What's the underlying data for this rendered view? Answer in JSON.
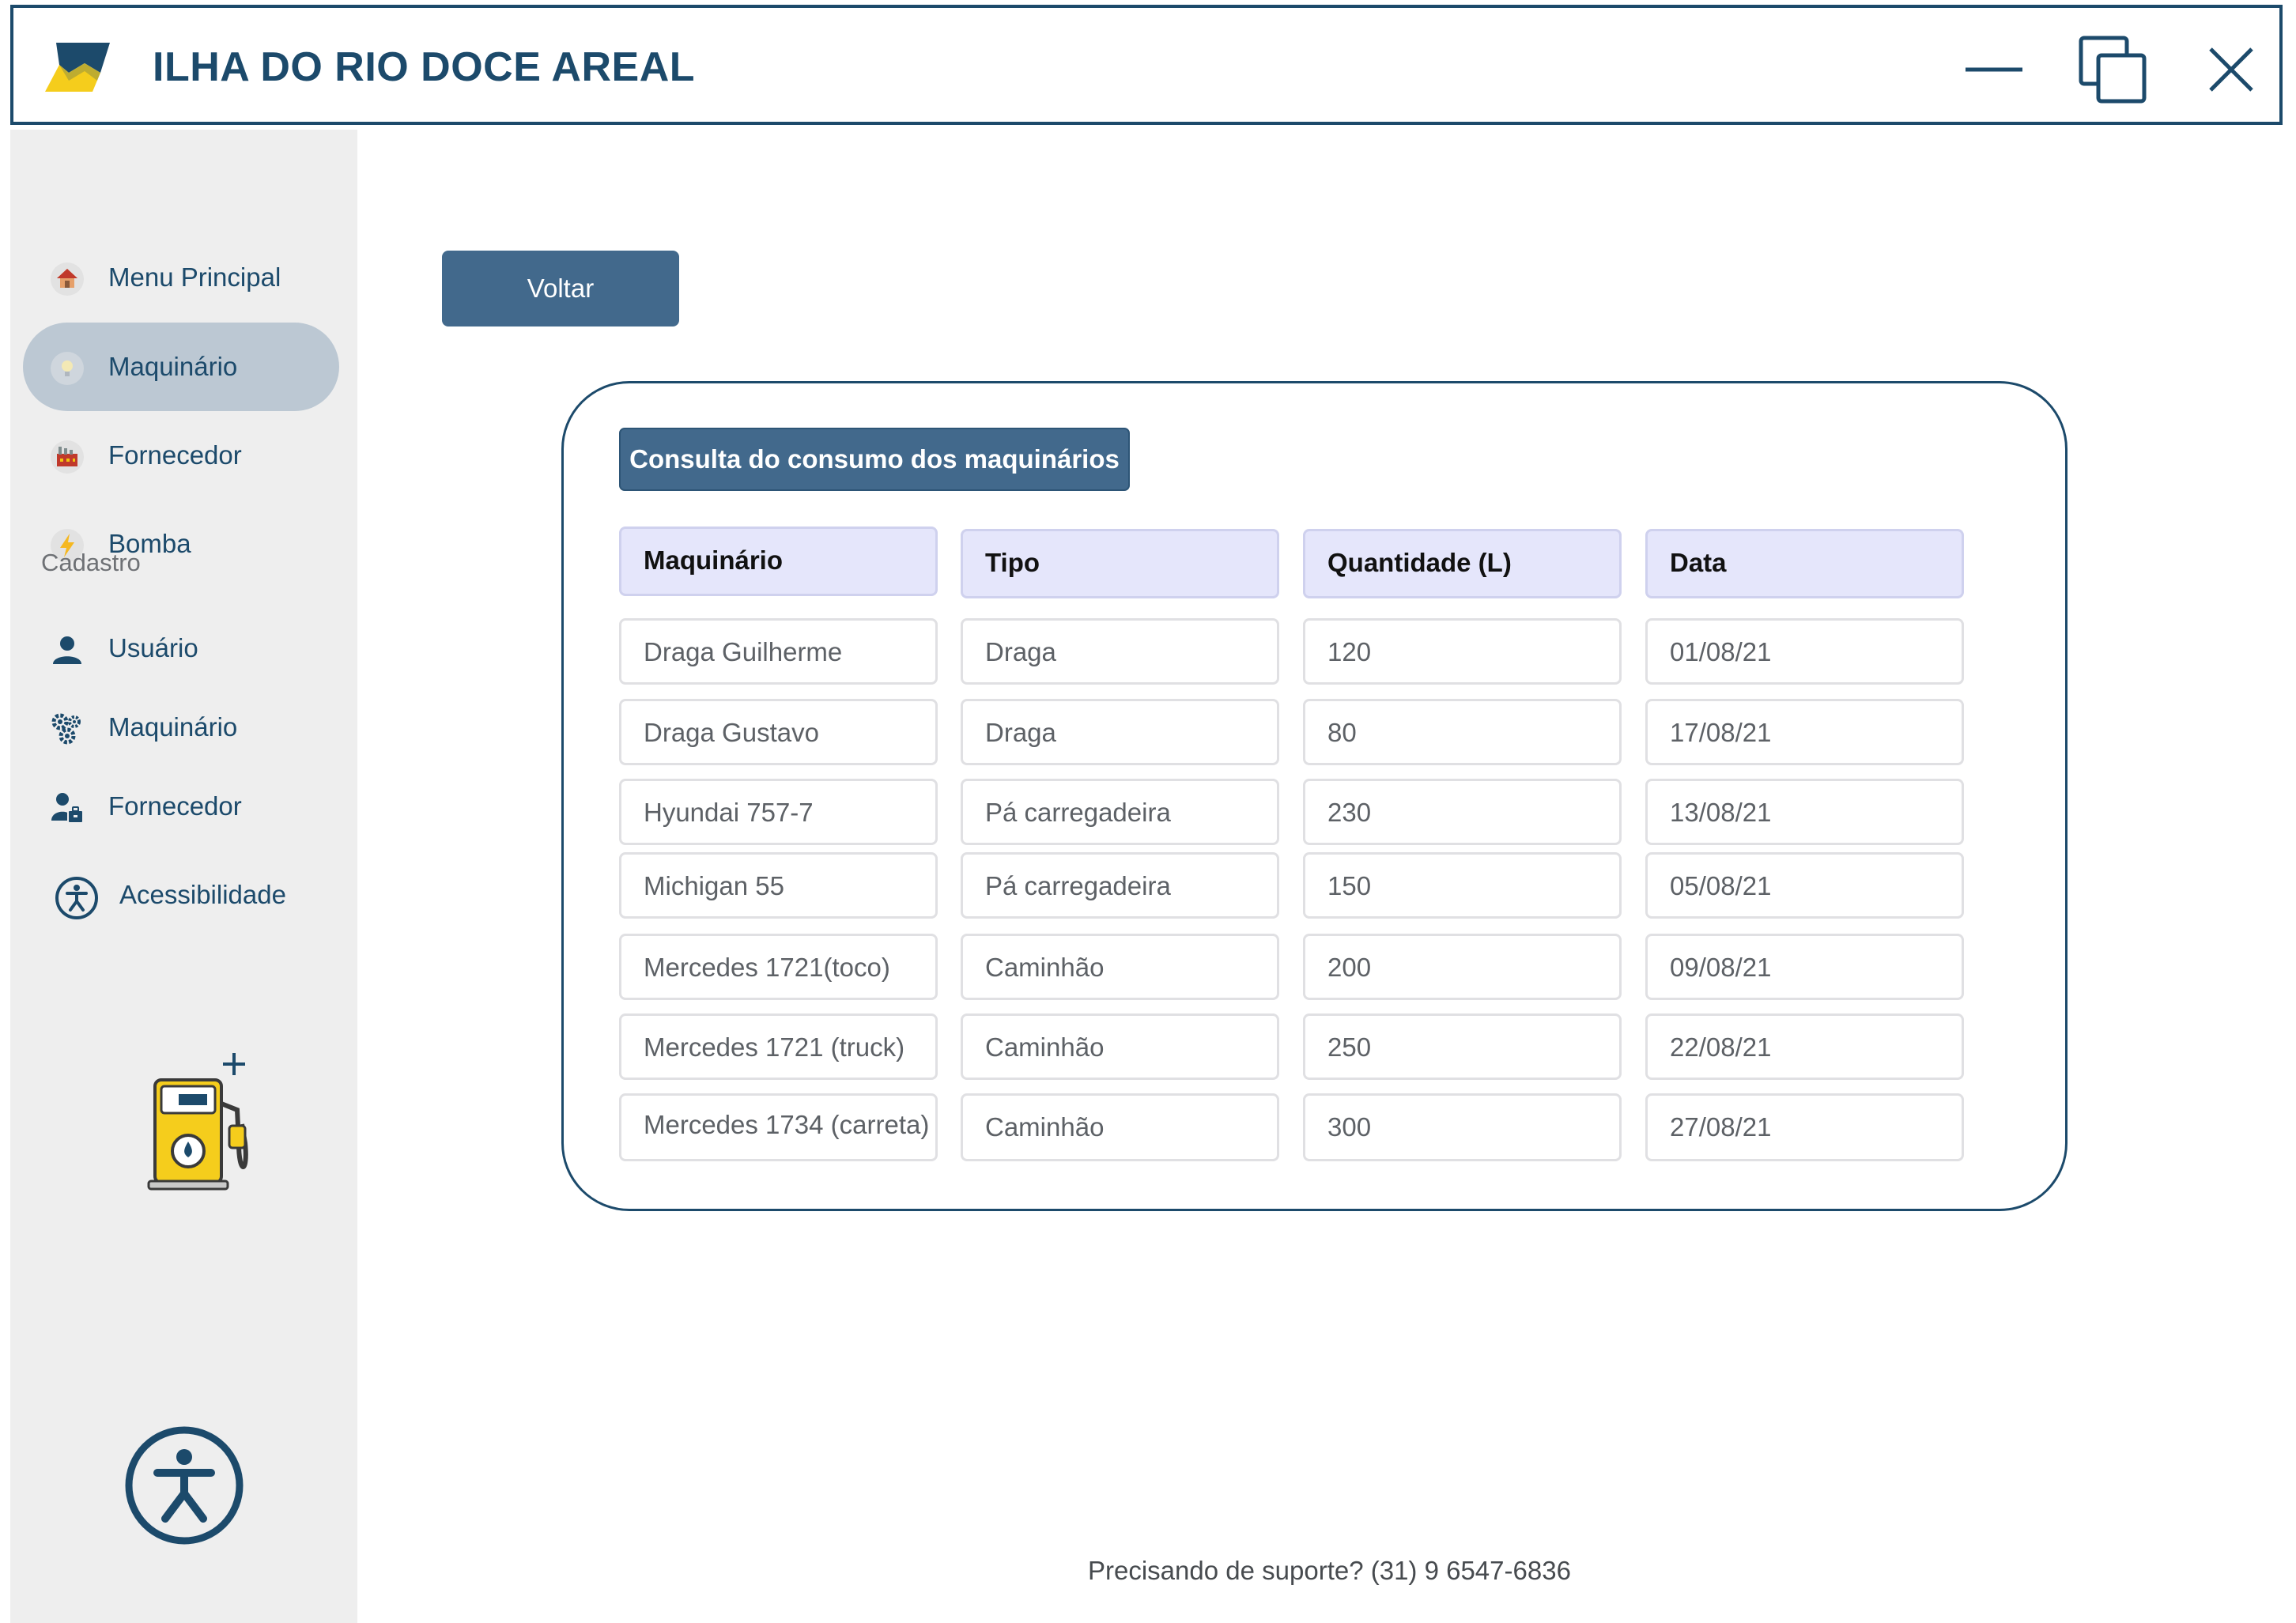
{
  "app": {
    "title": "ILHA DO RIO DOCE AREAL"
  },
  "window_controls": {
    "minimize_icon": "minimize-icon",
    "restore_icon": "restore-icon",
    "close_icon": "close-icon"
  },
  "sidebar": {
    "items": [
      {
        "label": "Menu Principal",
        "icon": "house-icon"
      },
      {
        "label": "Maquinário",
        "icon": "lightbulb-icon"
      },
      {
        "label": "Fornecedor",
        "icon": "factory-icon"
      },
      {
        "label": "Bomba",
        "icon": "lightning-icon"
      }
    ],
    "section_label": "Cadastro",
    "cadastro_items": [
      {
        "label": "Usuário",
        "icon": "user-icon"
      },
      {
        "label": "Maquinário",
        "icon": "gears-icon"
      },
      {
        "label": "Fornecedor",
        "icon": "supplier-icon"
      }
    ],
    "accessibility_label": "Acessibilidade"
  },
  "main": {
    "back_label": "Voltar",
    "panel_title": "Consulta do consumo dos maquinários",
    "table": {
      "headers": [
        "Maquinário",
        "Tipo",
        "Quantidade (L)",
        "Data"
      ],
      "rows": [
        [
          "Draga Guilherme",
          "Draga",
          "120",
          "01/08/21"
        ],
        [
          "Draga Gustavo",
          "Draga",
          "80",
          "17/08/21"
        ],
        [
          "Hyundai 757-7",
          "Pá carregadeira",
          "230",
          "13/08/21"
        ],
        [
          "Michigan 55",
          "Pá carregadeira",
          "150",
          "05/08/21"
        ],
        [
          "Mercedes 1721(toco)",
          "Caminhão",
          "200",
          "09/08/21"
        ],
        [
          "Mercedes 1721 (truck)",
          "Caminhão",
          "250",
          "22/08/21"
        ],
        [
          "Mercedes 1734 (carreta)",
          "Caminhão",
          "300",
          "27/08/21"
        ]
      ]
    }
  },
  "footer": {
    "support_text": "Precisando de suporte? (31) 9 6547-6836"
  },
  "colors": {
    "brand": "#1c4a6b",
    "button": "#42698c",
    "sidebar_bg": "#eeeeee",
    "sidebar_active": "#bcc8d3",
    "header_cell_bg": "#e5e6fb",
    "logo_yellow": "#f5cd1c"
  }
}
